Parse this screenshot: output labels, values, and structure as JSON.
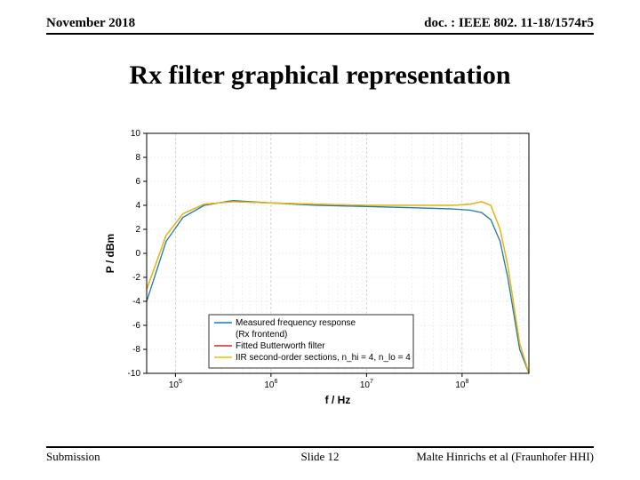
{
  "header": {
    "date": "November 2018",
    "docref": "doc. : IEEE 802. 11-18/1574r5"
  },
  "title": "Rx filter graphical representation",
  "footer": {
    "left": "Submission",
    "center": "Slide 12",
    "right": "Malte Hinrichs et al (Fraunhofer HHI)"
  },
  "chart_data": {
    "type": "line",
    "xlabel": "f / Hz",
    "ylabel": "P / dBm",
    "xscale": "log",
    "xlim": [
      50000,
      500000000
    ],
    "ylim": [
      -10,
      10
    ],
    "xticks": [
      100000,
      1000000,
      10000000,
      100000000
    ],
    "xtick_labels": [
      "10^5",
      "10^6",
      "10^7",
      "10^8"
    ],
    "yticks": [
      -10,
      -8,
      -6,
      -4,
      -2,
      0,
      2,
      4,
      6,
      8,
      10
    ],
    "legend": {
      "entries": [
        "Measured frequency response (Rx frontend)",
        "Fitted Butterworth filter",
        "IIR second-order sections, n_hi = 4, n_lo = 4"
      ],
      "position": "lower-center"
    },
    "series": [
      {
        "name": "Measured frequency response (Rx frontend)",
        "color": "#1f77b4",
        "x": [
          50000,
          80000,
          120000,
          200000,
          400000,
          1000000,
          3000000,
          10000000,
          30000000,
          80000000,
          120000000,
          160000000,
          200000000,
          250000000,
          300000000,
          400000000,
          500000000
        ],
        "y": [
          -4.0,
          1.0,
          3.0,
          4.0,
          4.4,
          4.2,
          4.0,
          3.9,
          3.8,
          3.7,
          3.6,
          3.4,
          2.8,
          1.0,
          -2.0,
          -8.0,
          -10.0
        ]
      },
      {
        "name": "Fitted Butterworth filter",
        "color": "#d62728",
        "x": [
          50000,
          80000,
          120000,
          200000,
          400000,
          1000000,
          3000000,
          10000000,
          30000000,
          80000000,
          120000000,
          160000000,
          200000000,
          250000000,
          300000000,
          400000000,
          500000000
        ],
        "y": [
          -3.0,
          1.5,
          3.3,
          4.1,
          4.3,
          4.2,
          4.1,
          4.0,
          4.0,
          4.0,
          4.1,
          4.3,
          4.0,
          2.0,
          -1.0,
          -7.5,
          -10.0
        ]
      },
      {
        "name": "IIR second-order sections",
        "color": "#e6c200",
        "x": [
          50000,
          80000,
          120000,
          200000,
          400000,
          1000000,
          3000000,
          10000000,
          30000000,
          80000000,
          120000000,
          160000000,
          200000000,
          250000000,
          300000000,
          400000000,
          500000000
        ],
        "y": [
          -3.0,
          1.5,
          3.3,
          4.1,
          4.3,
          4.2,
          4.1,
          4.0,
          4.0,
          4.0,
          4.1,
          4.3,
          4.0,
          2.0,
          -1.0,
          -7.5,
          -10.0
        ]
      }
    ]
  }
}
